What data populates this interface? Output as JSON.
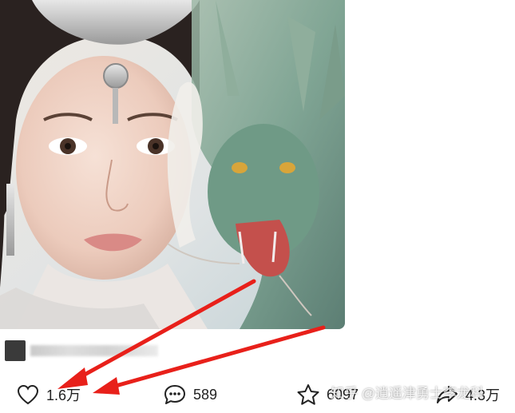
{
  "post": {
    "image_subject": "portrait of woman with silver headdress and jade dragon"
  },
  "author": {
    "name_hidden": true
  },
  "actions": {
    "like": {
      "icon": "heart-icon",
      "count": "1.6万"
    },
    "comment": {
      "icon": "comment-icon",
      "count": "589"
    },
    "favorite": {
      "icon": "star-icon",
      "count": "6097"
    },
    "share": {
      "icon": "share-icon",
      "count": "4.3万"
    }
  },
  "watermark": {
    "text": "知乎 @逍遥津勇士李龙科"
  },
  "annotation": {
    "arrow_color": "#e8201a"
  }
}
